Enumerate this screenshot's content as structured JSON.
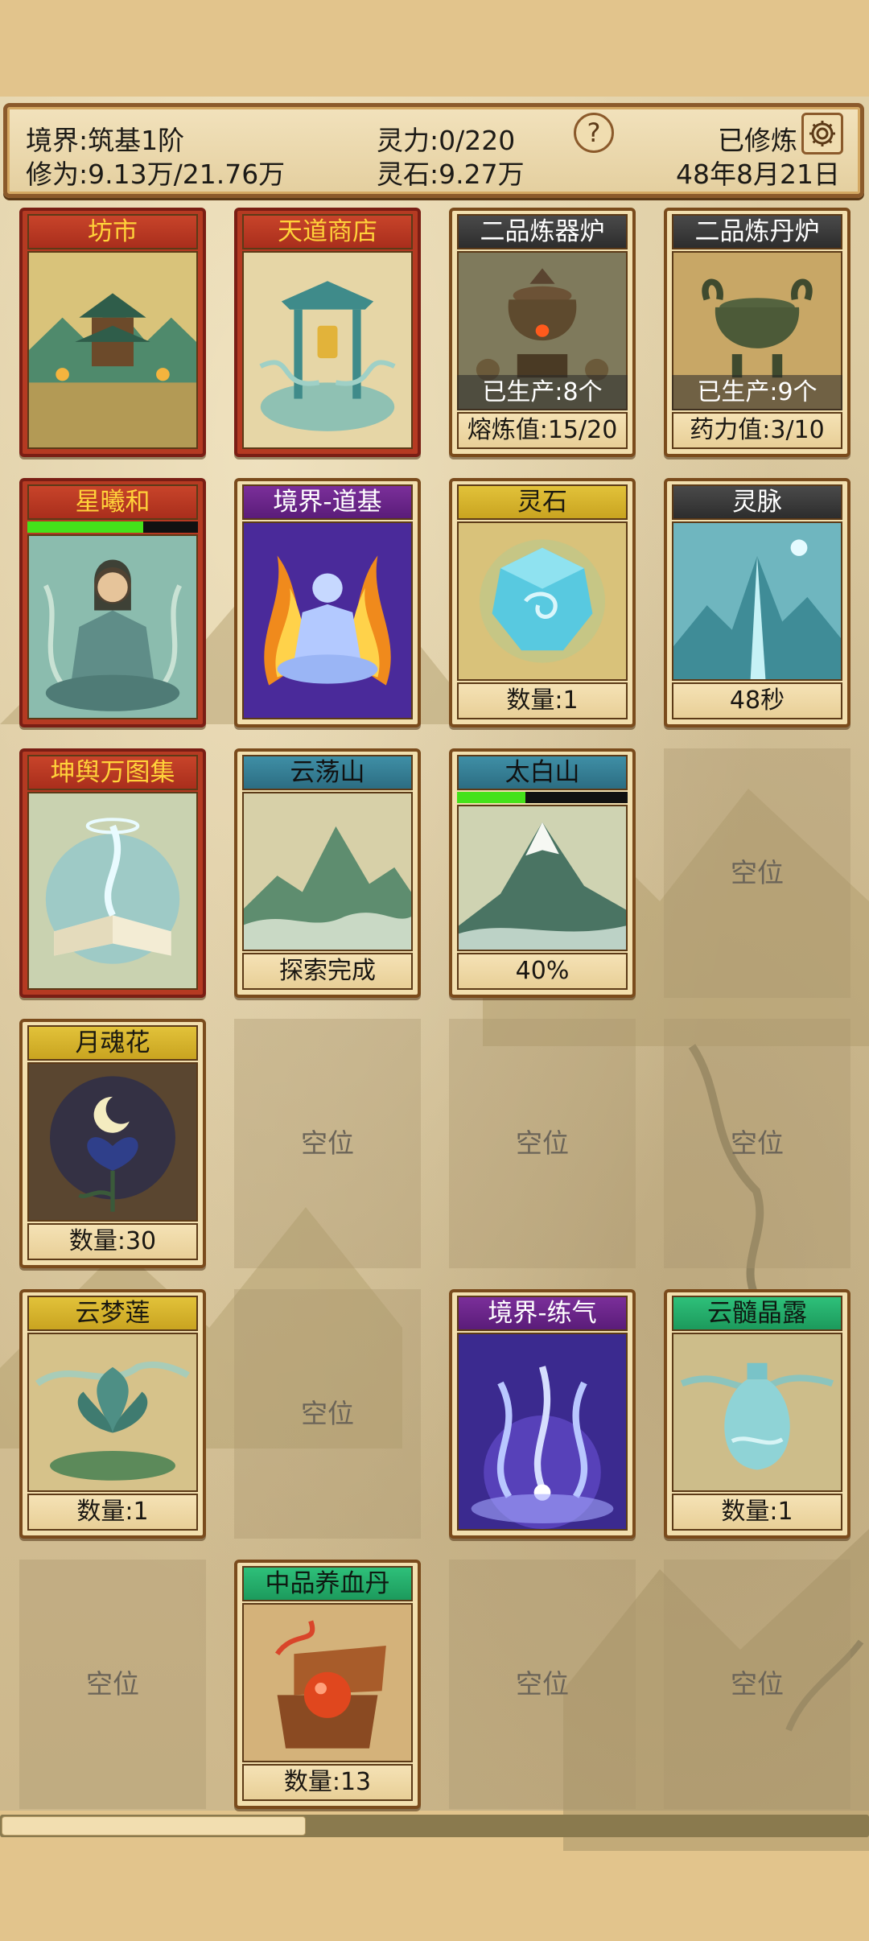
{
  "header": {
    "realm": "境界:筑基1阶",
    "cultivation": "修为:9.13万/21.76万",
    "spirit_power": "灵力:0/220",
    "spirit_stones": "灵石:9.27万",
    "help_symbol": "?",
    "cultivated_status": "已修炼",
    "game_date": "48年8月21日"
  },
  "cards": {
    "market": {
      "title": "坊市"
    },
    "heaven_shop": {
      "title": "天道商店"
    },
    "artifact_furnace": {
      "title": "二品炼器炉",
      "produced": "已生产:8个",
      "footer": "熔炼值:15/20"
    },
    "pill_furnace": {
      "title": "二品炼丹炉",
      "produced": "已生产:9个",
      "footer": "药力值:3/10"
    },
    "character": {
      "title": "星曦和",
      "hp_fraction": 0.68
    },
    "realm_daoji": {
      "title": "境界-道基"
    },
    "spirit_stone": {
      "title": "灵石",
      "footer": "数量:1"
    },
    "spirit_vein": {
      "title": "灵脉",
      "footer": "48秒"
    },
    "atlas": {
      "title": "坤舆万图集"
    },
    "yundang_mountain": {
      "title": "云荡山",
      "footer": "探索完成"
    },
    "taibai_mountain": {
      "title": "太白山",
      "footer": "40%",
      "progress_fraction": 0.4
    },
    "moon_soul_flower": {
      "title": "月魂花",
      "footer": "数量:30"
    },
    "cloud_dream_lotus": {
      "title": "云梦莲",
      "footer": "数量:1"
    },
    "realm_lianqi": {
      "title": "境界-练气"
    },
    "cloud_marrow_dew": {
      "title": "云髓晶露",
      "footer": "数量:1"
    },
    "blood_pill": {
      "title": "中品养血丹",
      "footer": "数量:13"
    }
  },
  "empty_label": "空位",
  "colors": {
    "title_red": "#c8442a",
    "title_text_gold": "#ffd23a",
    "progress_green": "#44e21a",
    "frame_brown": "#7a4b1c"
  }
}
